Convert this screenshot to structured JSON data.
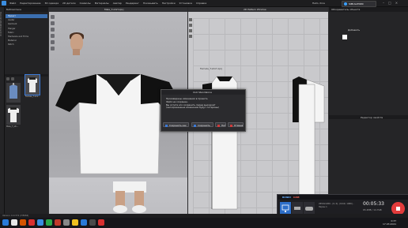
{
  "menubar": {
    "items": [
      "Файл",
      "Редактирование",
      "3D одежда",
      "2D детали",
      "Символы",
      "Материалы",
      "Аватар",
      "Рендеринг",
      "Показывать",
      "Настройки",
      "Установка",
      "Справка"
    ],
    "user": "Hello, Ilina",
    "simulation_label": "SIMULATION"
  },
  "side_strip": {
    "label": "ВСЕ/ЛЮБИМЫЕ ИКОНЫ"
  },
  "library": {
    "title": "Библиотека",
    "items": [
      "Проект",
      "Avatar",
      "Garment",
      "Hanger",
      "Fabric",
      "Hardware and Trims",
      "Material",
      "Stitch"
    ],
    "selected_index": 0,
    "thumbnails": [
      {
        "label": "",
        "kind": "hanger"
      },
      {
        "label": "Female_T-shir...",
        "kind": "tshirt"
      },
      {
        "label": "Male_T_shi...",
        "kind": "tshirt"
      }
    ]
  },
  "viewport3d": {
    "title": "Male_T-shirt.zprj"
  },
  "viewport2d": {
    "title": "2D Pattern Window",
    "file_label": "Female_T-shirt.zprj"
  },
  "object_panel": {
    "title": "Обозреватель объекта",
    "add_label": "Добавить",
    "swatch_color": "#ffffff",
    "editor_title": "Редактор свойств"
  },
  "dialog": {
    "title": "CLO Standalone",
    "message": [
      "Произведены изменения в проекте.",
      "Файл не сохранен.",
      "Вы хотите его сохранить перед выходом?",
      "(несохраненные изменения будут потеряны)"
    ],
    "buttons": [
      "Сохранить как",
      "Сохранить",
      "Нет",
      "Отмена"
    ]
  },
  "recorder": {
    "brand": "BANDI",
    "brand_suffix": "CAM",
    "time": "00:05:33",
    "size": "65.4MB / 14.7GB",
    "mode_info": "2650x1280 - (0, 0), (1919, 1080) - Экран 1"
  },
  "status": {
    "text": "Version: 6.0.374 (r35062)"
  },
  "taskbar": {
    "time": "0:37",
    "date": "17.03.2021",
    "icon_colors": [
      "#2a7ad8",
      "#e8e8e8",
      "#d35400",
      "#d93030",
      "#3a8de0",
      "#2aa84a",
      "#c0392b",
      "#888888",
      "#f0c020",
      "#2a7ad8",
      "#4a4a4a",
      "#d93030"
    ]
  },
  "colors": {
    "accent_blue": "#3b7ad8",
    "record_red": "#e23b3b"
  }
}
